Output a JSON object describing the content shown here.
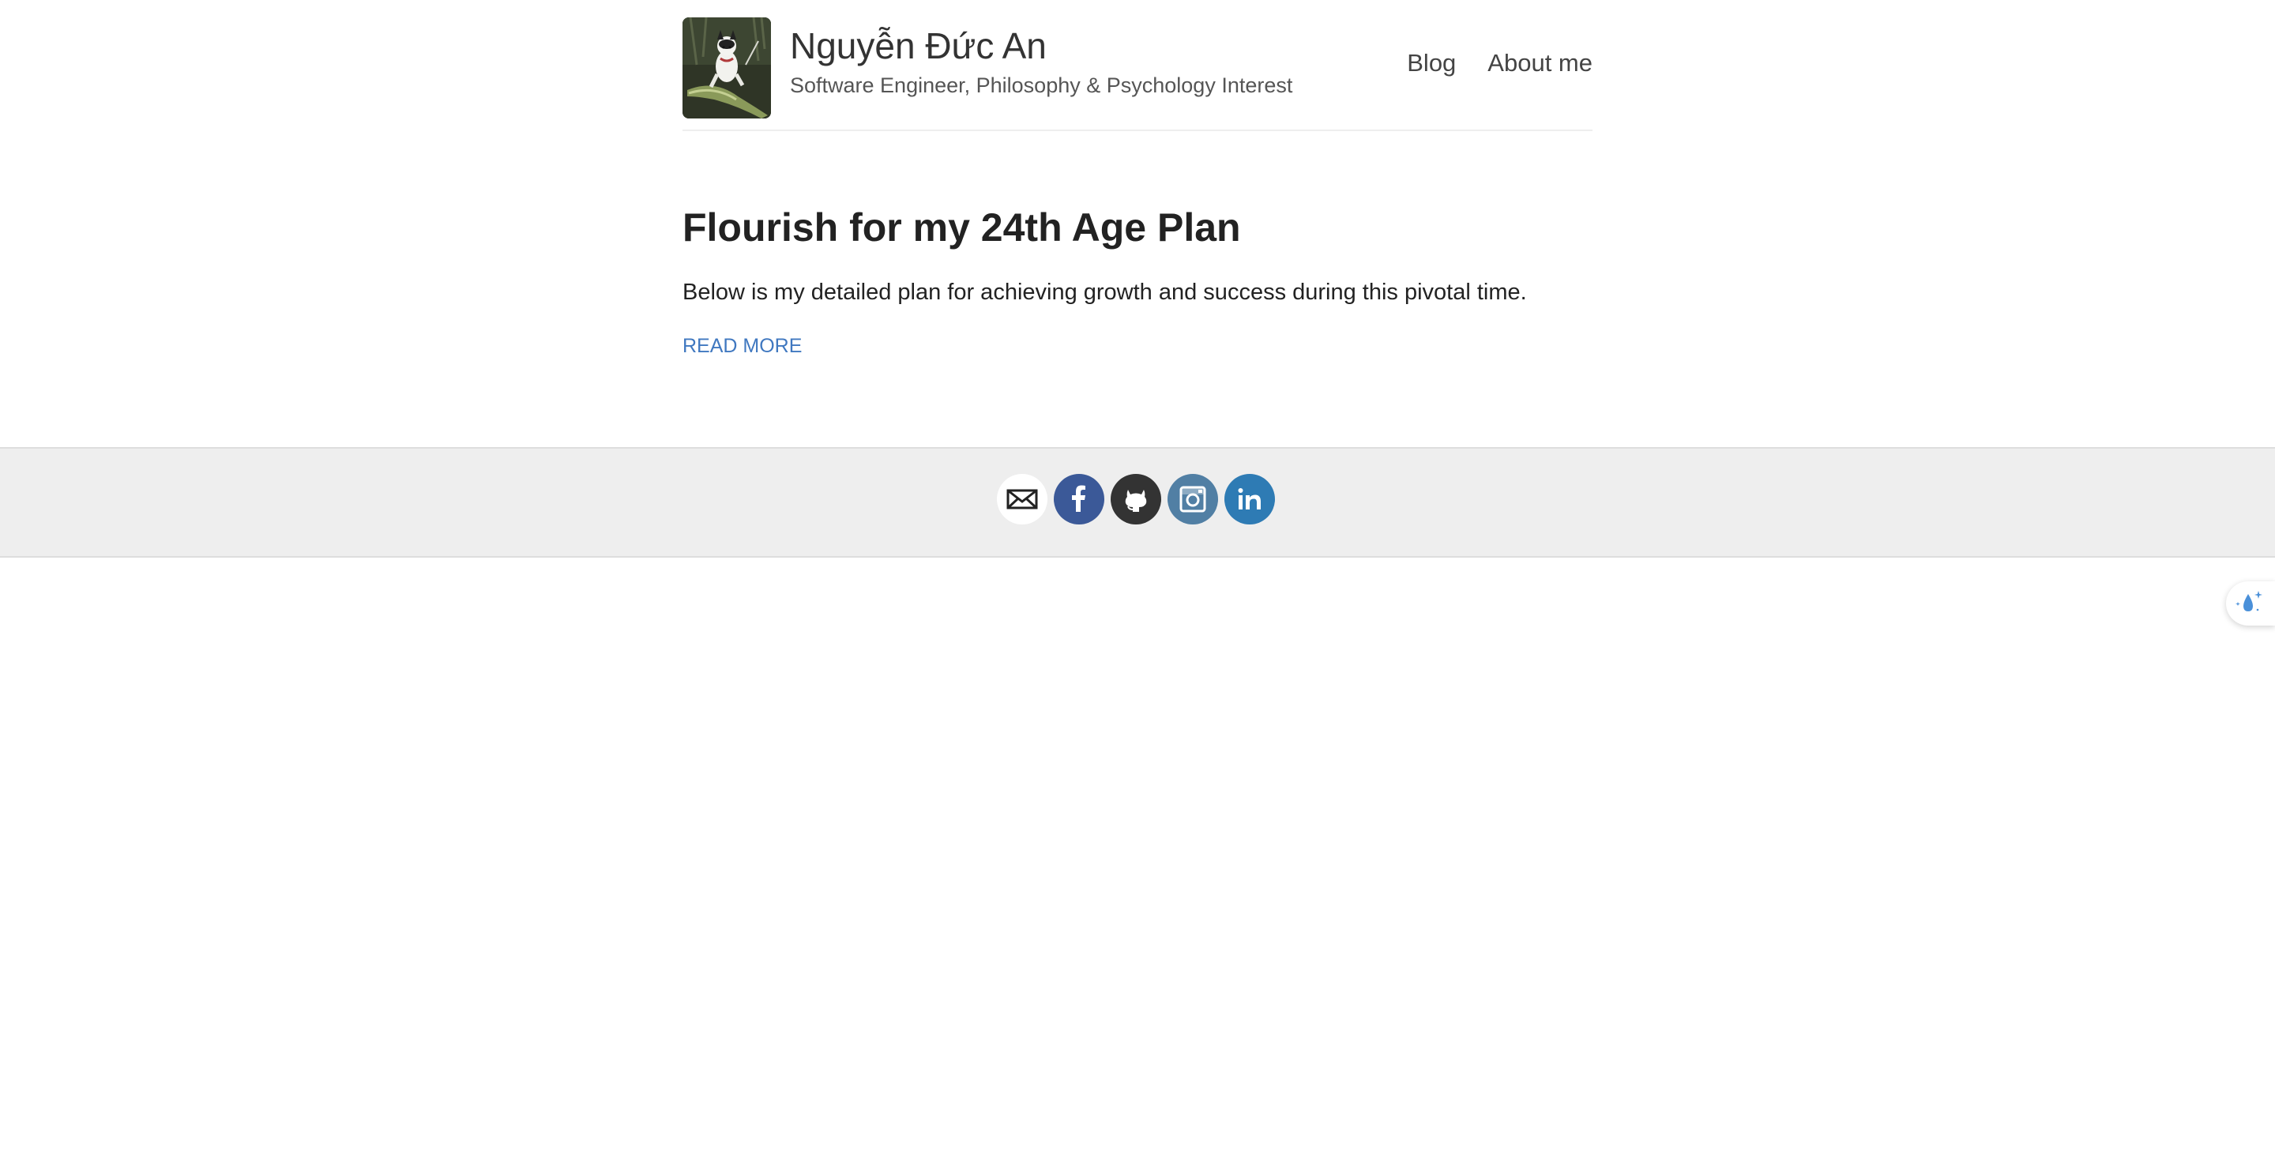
{
  "header": {
    "title": "Nguyễn Đức An",
    "subtitle": "Software Engineer, Philosophy & Psychology Interest",
    "avatar_alt": "avatar",
    "nav": [
      {
        "label": "Blog"
      },
      {
        "label": "About me"
      }
    ]
  },
  "post": {
    "title": "Flourish for my 24th Age Plan",
    "excerpt": "Below is my detailed plan for achieving growth and success during this pivotal time.",
    "read_more": "READ MORE"
  },
  "footer": {
    "social": [
      {
        "icon": "email-icon",
        "color": "#ffffff"
      },
      {
        "icon": "facebook-icon",
        "color": "#3b5998"
      },
      {
        "icon": "github-icon",
        "color": "#333333"
      },
      {
        "icon": "instagram-icon",
        "color": "#517fa4"
      },
      {
        "icon": "linkedin-icon",
        "color": "#2e7bb4"
      }
    ]
  },
  "widget": {
    "icon": "water-drop-sparkle-icon",
    "color": "#4a90d9"
  },
  "colors": {
    "link": "#4078c0",
    "footer_bg": "#eeeeee"
  }
}
